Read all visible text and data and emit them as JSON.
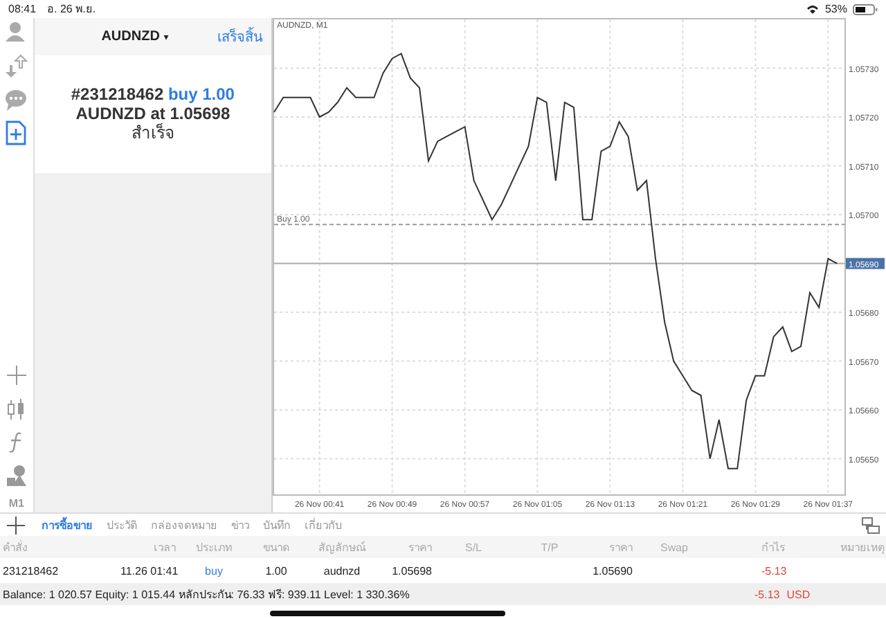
{
  "status_bar": {
    "time": "08:41",
    "date": "อ. 26 พ.ย.",
    "battery": "53%"
  },
  "rail": {
    "top_tools": [
      {
        "kind": "account",
        "selected": false
      },
      {
        "kind": "trade",
        "selected": false
      },
      {
        "kind": "chat",
        "selected": false
      },
      {
        "kind": "new-order",
        "selected": true
      }
    ],
    "chart_tools": [
      {
        "kind": "crosshair"
      },
      {
        "kind": "candles"
      },
      {
        "kind": "function"
      },
      {
        "kind": "shapes"
      },
      {
        "kind": "timeframe",
        "label": "M1"
      }
    ]
  },
  "order_panel": {
    "symbol": "AUDNZD",
    "caret": "▾",
    "done_button": "เสร็จสิ้น",
    "ticket": "#231218462",
    "action": "buy 1.00",
    "line2": "AUDNZD at 1.05698",
    "result": "สำเร็จ"
  },
  "chart": {
    "chart_data": {
      "type": "line",
      "title": "AUDNZD, M1",
      "categories": [
        null,
        null,
        null,
        null,
        null,
        "26 Nov 00:41",
        null,
        null,
        null,
        null,
        null,
        null,
        null,
        "26 Nov 00:49",
        null,
        null,
        null,
        null,
        null,
        null,
        null,
        "26 Nov 00:57",
        null,
        null,
        null,
        null,
        null,
        null,
        null,
        "26 Nov 01:05",
        null,
        null,
        null,
        null,
        null,
        null,
        null,
        "26 Nov 01:13",
        null,
        null,
        null,
        null,
        null,
        null,
        null,
        "26 Nov 01:21",
        null,
        null,
        null,
        null,
        null,
        null,
        null,
        "26 Nov 01:29",
        null,
        null,
        null,
        null,
        null,
        null,
        null,
        "26 Nov 01:37",
        null
      ],
      "series": [
        {
          "color": "#333333",
          "values": [
            1.05721,
            1.05724,
            1.05724,
            1.05724,
            1.05724,
            1.0572,
            1.05721,
            1.05723,
            1.05726,
            1.05724,
            1.05724,
            1.05724,
            1.05729,
            1.05732,
            1.05733,
            1.05728,
            1.05726,
            1.05711,
            1.05715,
            1.05716,
            1.05717,
            1.05718,
            1.05707,
            1.05703,
            1.05699,
            1.05702,
            1.05706,
            1.0571,
            1.05714,
            1.05724,
            1.05723,
            1.05707,
            1.05723,
            1.05722,
            1.05699,
            1.05699,
            1.05713,
            1.05714,
            1.05719,
            1.05716,
            1.05705,
            1.05707,
            1.05691,
            1.05678,
            1.0567,
            1.05667,
            1.05664,
            1.05663,
            1.0565,
            1.05658,
            1.05648,
            1.05648,
            1.05662,
            1.05667,
            1.05667,
            1.05675,
            1.05677,
            1.05672,
            1.05673,
            1.05684,
            1.05681,
            1.05691,
            1.0569
          ]
        }
      ],
      "ylim": [
        1.05643,
        1.0574
      ],
      "yticks": [
        {
          "value": 1.0565,
          "label": "1.05650"
        },
        {
          "value": 1.0566,
          "label": "1.05660"
        },
        {
          "value": 1.0567,
          "label": "1.05670"
        },
        {
          "value": 1.0568,
          "label": "1.05680"
        },
        {
          "value": 1.057,
          "label": "1.05700"
        },
        {
          "value": 1.0571,
          "label": "1.05710"
        },
        {
          "value": 1.0572,
          "label": "1.05720"
        },
        {
          "value": 1.0573,
          "label": "1.05730"
        }
      ],
      "grid": true,
      "ref_lines": [
        {
          "axis": "y",
          "value": 1.05698,
          "label": "Buy 1.00"
        },
        {
          "axis": "y",
          "value": 1.0569,
          "label": "1.05690"
        }
      ]
    }
  },
  "terminal": {
    "tabs": [
      {
        "label": "การซื้อขาย",
        "selected": true
      },
      {
        "label": "ประวัติ",
        "selected": false
      },
      {
        "label": "กล่องจดหมาย",
        "selected": false
      },
      {
        "label": "ข่าว",
        "selected": false
      },
      {
        "label": "บันทึก",
        "selected": false
      },
      {
        "label": "เกี่ยวกับ",
        "selected": false
      }
    ],
    "columns": [
      "คำสั่ง",
      "เวลา",
      "ประเภท",
      "ขนาด",
      "สัญลักษณ์",
      "ราคา",
      "S/L",
      "T/P",
      "ราคา",
      "Swap",
      "กำไร",
      "หมายเหตุ"
    ],
    "rows": [
      {
        "cells": [
          "231218462",
          "11.26 01:41",
          "buy",
          "1.00",
          "audnzd",
          "1.05698",
          null,
          null,
          "1.05690",
          null,
          "-5.13",
          null
        ]
      }
    ],
    "summary": {
      "text": "Balance: 1 020.57 Equity: 1 015.44 หลักประกัน: 76.33 ฟรี: 939.11 Level: 1 330.36%",
      "profit": "-5.13",
      "currency": "USD"
    }
  }
}
